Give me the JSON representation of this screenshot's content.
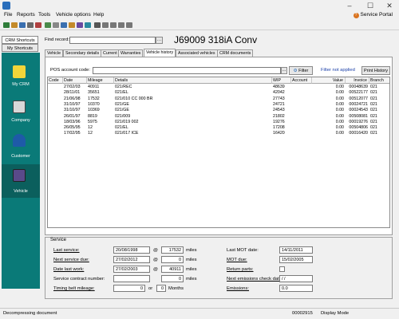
{
  "menu": {
    "items": [
      "File",
      "Reports",
      "Tools",
      "Vehicle options",
      "Help"
    ],
    "portal": "Service Portal"
  },
  "sidebar": {
    "tabs": [
      "CRM Shortcuts",
      "My Shortcuts"
    ],
    "items": [
      {
        "label": "My CRM",
        "icon": "sticky-note-icon",
        "color": "#f2d53a"
      },
      {
        "label": "Company",
        "icon": "building-icon",
        "color": "#d8d8d8"
      },
      {
        "label": "Customer",
        "icon": "person-icon",
        "color": "#e0e0e0"
      },
      {
        "label": "Vehicle",
        "icon": "vehicle-icon",
        "color": "#5a4a8a"
      }
    ]
  },
  "header": {
    "find_label": "Find record:",
    "find_value": "",
    "title": "J69009 318iA Conv"
  },
  "tabs": [
    "Vehicle",
    "Secondary details",
    "Current",
    "Warranties",
    "Vehicle history",
    "Associated vehicles",
    "CRM documents"
  ],
  "history": {
    "pos_label": "POS account code:",
    "pos_value": "",
    "filter_label": "Filter",
    "filter_status": "Filter not applied",
    "print_label": "Print History",
    "columns": [
      "Code",
      "Date",
      "Mileage",
      "Details",
      "WIP",
      "Account",
      "Value",
      "Invoice",
      "Branch"
    ],
    "rows": [
      {
        "code": "",
        "date": "27/02/03",
        "mileage": "40911",
        "details": "021/REC",
        "wip": "48639",
        "account": "",
        "value": "0.00",
        "invoice": "00048639",
        "branch": "021"
      },
      {
        "code": "",
        "date": "28/11/01",
        "mileage": "35651",
        "details": "021/EL",
        "wip": "42042",
        "account": "",
        "value": "0.00",
        "invoice": "00522177",
        "branch": "021"
      },
      {
        "code": "",
        "date": "21/06/98",
        "mileage": "17532",
        "details": "021/010 CC 000 BR",
        "wip": "27743",
        "account": "",
        "value": "0.00",
        "invoice": "00512077",
        "branch": "021"
      },
      {
        "code": "",
        "date": "31/10/97",
        "mileage": "10370",
        "details": "021/GE",
        "wip": "24721",
        "account": "",
        "value": "0.00",
        "invoice": "00024721",
        "branch": "021"
      },
      {
        "code": "",
        "date": "31/10/97",
        "mileage": "10369",
        "details": "021/GE",
        "wip": "24543",
        "account": "",
        "value": "0.00",
        "invoice": "00024543",
        "branch": "021"
      },
      {
        "code": "",
        "date": "26/01/97",
        "mileage": "8819",
        "details": "021/009",
        "wip": "21802",
        "account": "",
        "value": "0.00",
        "invoice": "00508081",
        "branch": "021"
      },
      {
        "code": "",
        "date": "18/03/96",
        "mileage": "5975",
        "details": "021/019 002",
        "wip": "19276",
        "account": "",
        "value": "0.00",
        "invoice": "00019276",
        "branch": "021"
      },
      {
        "code": "",
        "date": "26/05/95",
        "mileage": "12",
        "details": "021/EL",
        "wip": "17208",
        "account": "",
        "value": "0.00",
        "invoice": "00504806",
        "branch": "021"
      },
      {
        "code": "",
        "date": "17/02/95",
        "mileage": "12",
        "details": "021/017 ICE",
        "wip": "16420",
        "account": "",
        "value": "0.00",
        "invoice": "00016420",
        "branch": "021"
      }
    ]
  },
  "service": {
    "title": "Service",
    "last_service_label": "Last service:",
    "last_service_date": "20/08/1998",
    "last_service_at": "@",
    "last_service_miles": "17532",
    "miles_unit": "miles",
    "next_service_label": "Next service due:",
    "next_service_date": "27/02/2012",
    "next_service_at": "@",
    "next_service_miles": "0",
    "date_last_work_label": "Date last work:",
    "date_last_work": "27/02/2003",
    "date_last_work_at": "@",
    "date_last_work_miles": "40911",
    "contract_label": "Service contract number:",
    "contract_value": "",
    "contract_miles": "0",
    "timing_label": "Timing belt mileage:",
    "timing_value": "0",
    "timing_or": "or",
    "timing_months": "0",
    "months_unit": "Months",
    "last_mot_label": "Last MOT date:",
    "last_mot": "14/11/2011",
    "mot_due_label": "MOT due:",
    "mot_due": "15/02/2005",
    "return_parts_label": "Return parts:",
    "emissions_check_label": "Next emissions check date:",
    "emissions_check": "  /  /",
    "emissions_label": "Emissions:",
    "emissions_value": "0.0"
  },
  "status": {
    "left": "Decompressing document",
    "code": "00002915",
    "mode": "Display Mode"
  }
}
